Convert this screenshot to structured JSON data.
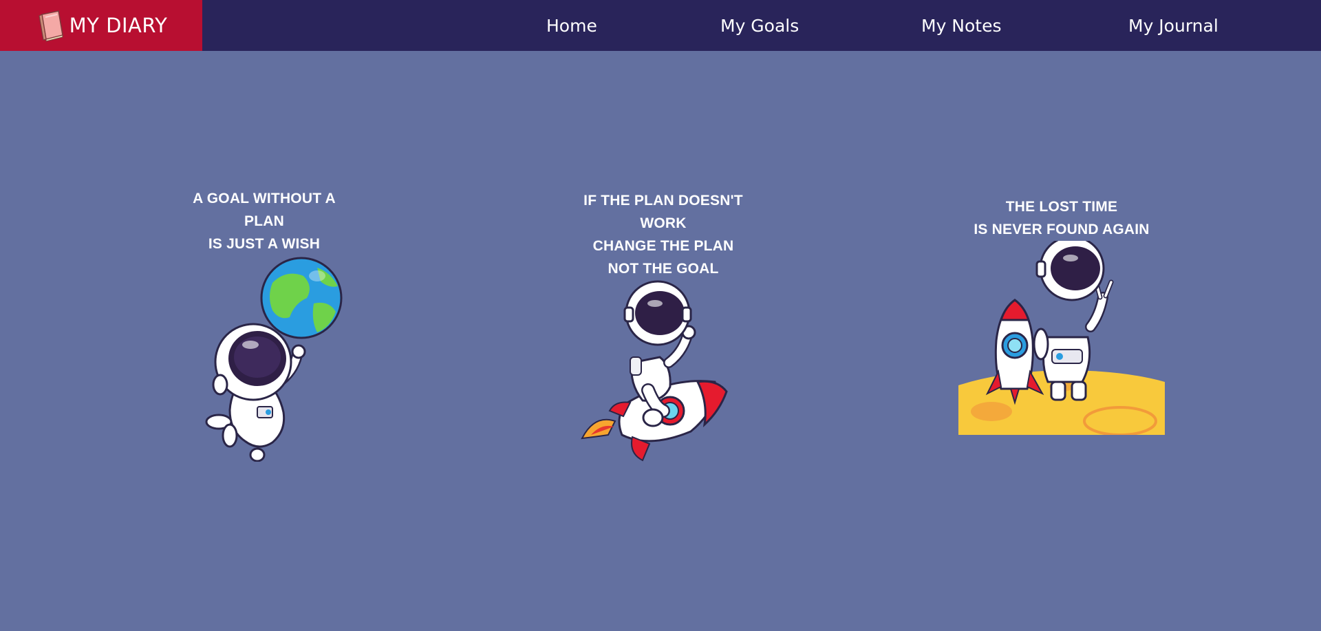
{
  "brand": {
    "title": "MY DIARY",
    "icon": "book-icon"
  },
  "nav": {
    "home": "Home",
    "goals": "My Goals",
    "notes": "My Notes",
    "journal": "My Journal"
  },
  "cards": [
    {
      "quote_lines": [
        "A GOAL WITHOUT A PLAN",
        "IS JUST A WISH"
      ],
      "illustration": "astronaut-with-globe-illustration"
    },
    {
      "quote_lines": [
        "IF THE PLAN DOESN'T WORK",
        "CHANGE THE PLAN",
        "NOT THE GOAL"
      ],
      "illustration": "astronaut-riding-rocket-illustration"
    },
    {
      "quote_lines": [
        "THE LOST TIME",
        "IS NEVER FOUND AGAIN"
      ],
      "illustration": "astronaut-on-moon-with-rocket-illustration"
    }
  ],
  "colors": {
    "page_background": "#6370a0",
    "navbar_background": "#29245a",
    "brand_background": "#b80f31",
    "text": "#ffffff"
  }
}
